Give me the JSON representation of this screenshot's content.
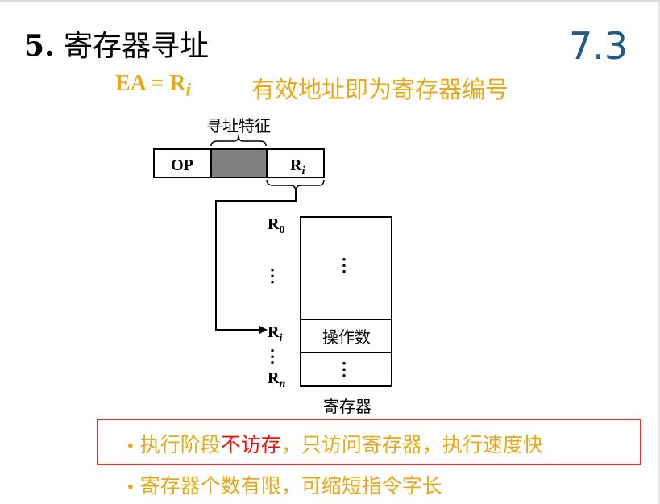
{
  "slide": {
    "title_num": "5.",
    "title_text": "寄存器寻址",
    "section": "7.3"
  },
  "formula": {
    "lhs": "EA = R",
    "sub": "i",
    "description": "有效地址即为寄存器编号"
  },
  "instruction": {
    "caption": "寻址特征",
    "op": "OP",
    "reg": "R",
    "reg_sub": "i"
  },
  "registers": {
    "r0": "R",
    "r0_sub": "0",
    "ri": "R",
    "ri_sub": "i",
    "rn": "R",
    "rn_sub": "n",
    "vdots": "⋮",
    "operand": "操作数",
    "caption": "寄存器"
  },
  "bullets": {
    "b1_pre": "执行阶段",
    "b1_red": "不访存",
    "b1_post": "，只访问寄存器，执行速度快",
    "b2": "寄存器个数有限，可缩短指令字长",
    "marker": "•"
  }
}
